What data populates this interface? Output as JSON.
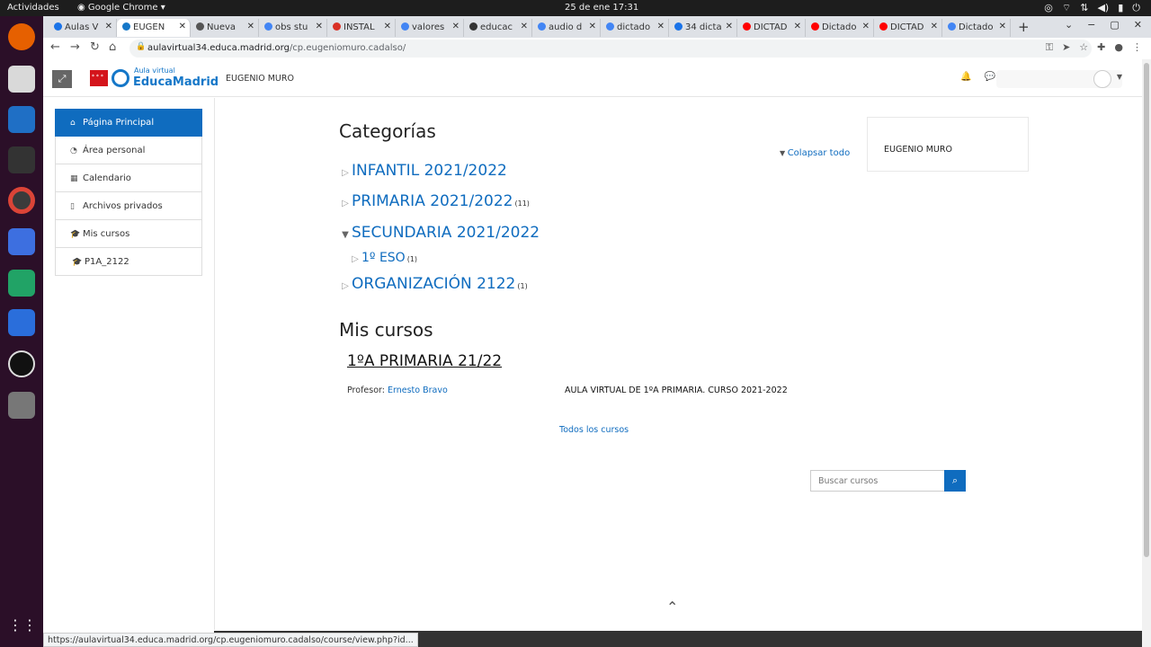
{
  "os": {
    "activities": "Actividades",
    "app_name": "Google Chrome",
    "clock": "25 de ene  17:31"
  },
  "browser": {
    "tabs": [
      {
        "label": "Aulas V",
        "color": "#1a73e8"
      },
      {
        "label": "EUGEN",
        "color": "#1577c8",
        "active": true
      },
      {
        "label": "Nueva",
        "color": "#555555"
      },
      {
        "label": "obs stu",
        "color": "#4285f4"
      },
      {
        "label": "INSTAL",
        "color": "#d93025"
      },
      {
        "label": "valores",
        "color": "#4285f4"
      },
      {
        "label": "educac",
        "color": "#333333"
      },
      {
        "label": "audio d",
        "color": "#4285f4"
      },
      {
        "label": "dictado",
        "color": "#4285f4"
      },
      {
        "label": "34 dicta",
        "color": "#1a73e8"
      },
      {
        "label": "DICTAD",
        "color": "#ff0000"
      },
      {
        "label": "Dictado",
        "color": "#ff0000"
      },
      {
        "label": "DICTAD",
        "color": "#ff0000"
      },
      {
        "label": "Dictado",
        "color": "#4285f4"
      }
    ],
    "url_host": "aulavirtual34.educa.madrid.org",
    "url_path": "/cp.eugeniomuro.cadalso/",
    "status_url": "https://aulavirtual34.educa.madrid.org/cp.eugeniomuro.cadalso/course/view.php?id..."
  },
  "header": {
    "logo_small": "Aula virtual",
    "logo_big": "EducaMadrid",
    "site_name": "EUGENIO MURO"
  },
  "nav": [
    {
      "label": "Página Principal",
      "icon": "home-icon",
      "glyph": "⌂"
    },
    {
      "label": "Área personal",
      "icon": "dashboard-icon",
      "glyph": "◔"
    },
    {
      "label": "Calendario",
      "icon": "calendar-icon",
      "glyph": "▦"
    },
    {
      "label": "Archivos privados",
      "icon": "file-icon",
      "glyph": "▯"
    },
    {
      "label": "Mis cursos",
      "icon": "graduation-cap-icon",
      "glyph": "🎓"
    },
    {
      "label": "P1A_2122",
      "icon": "graduation-cap-icon",
      "glyph": "🎓"
    }
  ],
  "main": {
    "categories_title": "Categorías",
    "collapse_all": "Colapsar todo",
    "categories": [
      {
        "name": "INFANTIL 2021/2022",
        "count": ""
      },
      {
        "name": "PRIMARIA 2021/2022",
        "count": "(11)"
      },
      {
        "name": "SECUNDARIA 2021/2022",
        "count": ""
      },
      {
        "name": "1º ESO",
        "count": "(1)"
      },
      {
        "name": "ORGANIZACIÓN 2122",
        "count": "(1)"
      }
    ],
    "my_courses_title": "Mis cursos",
    "course": {
      "title": "1ºA PRIMARIA 21/22",
      "teacher_label": "Profesor:",
      "teacher_name": "Ernesto Bravo",
      "summary": "AULA VIRTUAL DE 1ºA PRIMARIA. CURSO 2021-2022"
    },
    "all_courses": "Todos los cursos",
    "search_placeholder": "Buscar cursos"
  },
  "block": {
    "title": "EUGENIO MURO"
  }
}
